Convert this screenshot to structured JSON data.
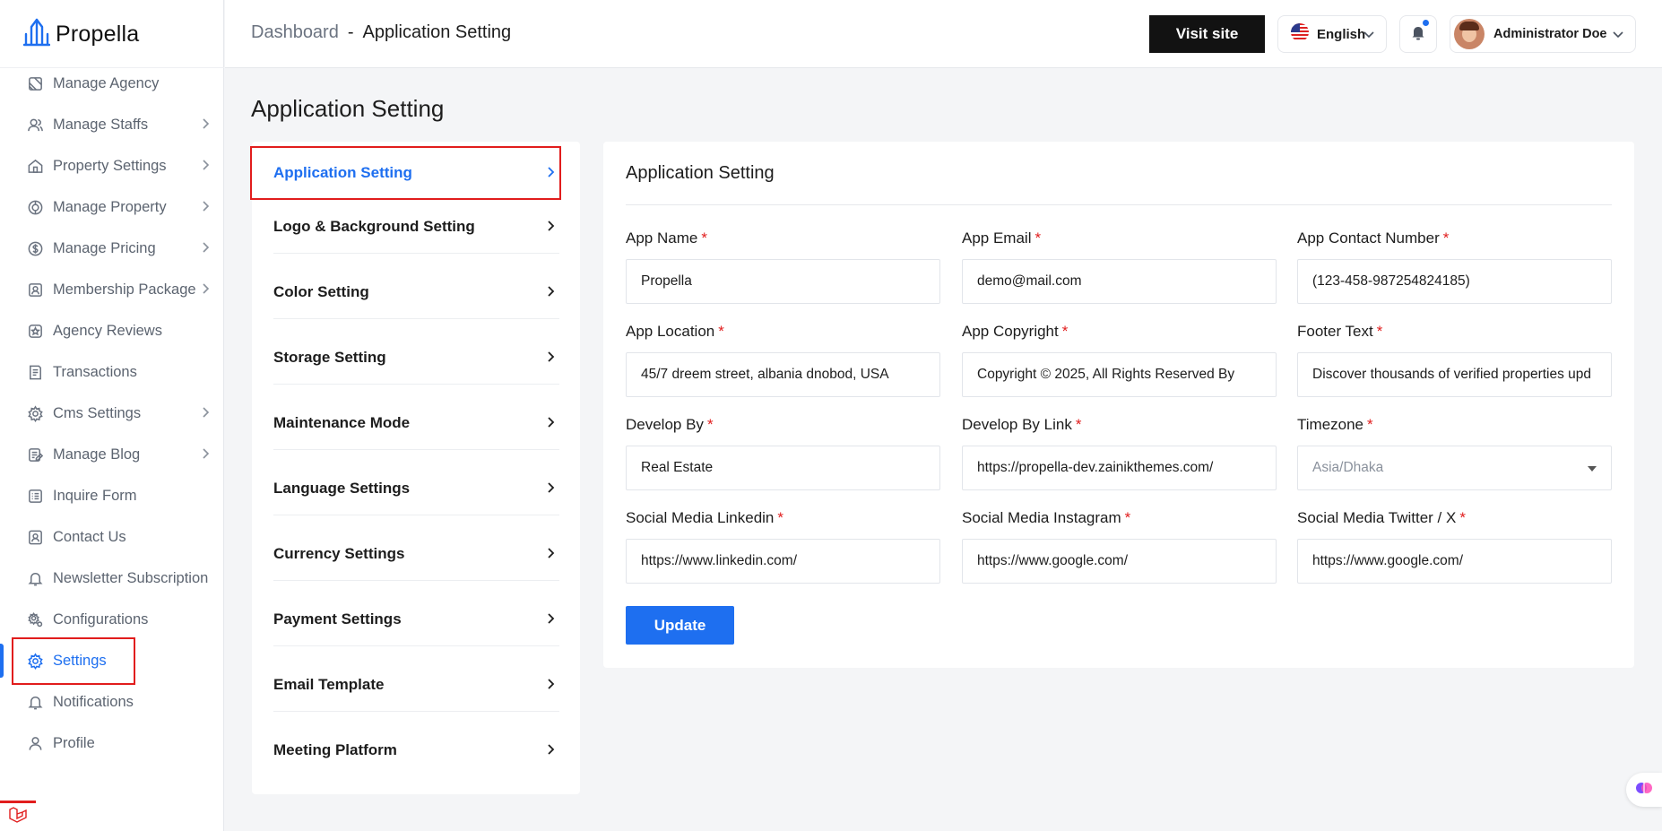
{
  "brand": {
    "name": "Propella",
    "accent": "#1e6ff0"
  },
  "sidebar": {
    "items": [
      {
        "label": "Manage Agency",
        "icon": "agency-icon",
        "chevron": false
      },
      {
        "label": "Manage Staffs",
        "icon": "users-icon",
        "chevron": true
      },
      {
        "label": "Property Settings",
        "icon": "home-icon",
        "chevron": true
      },
      {
        "label": "Manage Property",
        "icon": "property-icon",
        "chevron": true
      },
      {
        "label": "Manage Pricing",
        "icon": "dollar-icon",
        "chevron": true
      },
      {
        "label": "Membership Package",
        "icon": "membership-icon",
        "chevron": true
      },
      {
        "label": "Agency Reviews",
        "icon": "star-icon",
        "chevron": false
      },
      {
        "label": "Transactions",
        "icon": "receipt-icon",
        "chevron": false
      },
      {
        "label": "Cms Settings",
        "icon": "cog-icon",
        "chevron": true
      },
      {
        "label": "Manage Blog",
        "icon": "blog-icon",
        "chevron": true
      },
      {
        "label": "Inquire Form",
        "icon": "list-icon",
        "chevron": false
      },
      {
        "label": "Contact Us",
        "icon": "contact-icon",
        "chevron": false
      },
      {
        "label": "Newsletter Subscription",
        "icon": "bell-icon",
        "chevron": false
      },
      {
        "label": "Configurations",
        "icon": "cogs-icon",
        "chevron": false
      },
      {
        "label": "Settings",
        "icon": "settings-icon",
        "chevron": false,
        "active": true
      },
      {
        "label": "Notifications",
        "icon": "bell-icon",
        "chevron": false
      },
      {
        "label": "Profile",
        "icon": "user-icon",
        "chevron": false
      }
    ]
  },
  "header": {
    "breadcrumb": {
      "parent": "Dashboard",
      "separator": "-",
      "current": "Application Setting"
    },
    "visit_site": "Visit site",
    "language": "English",
    "user_name": "Administrator Doe"
  },
  "page_title": "Application Setting",
  "settings_tabs": [
    {
      "label": "Application Setting",
      "active": true
    },
    {
      "label": "Logo & Background Setting"
    },
    {
      "label": "Color Setting"
    },
    {
      "label": "Storage Setting"
    },
    {
      "label": "Maintenance Mode"
    },
    {
      "label": "Language Settings"
    },
    {
      "label": "Currency Settings"
    },
    {
      "label": "Payment Settings"
    },
    {
      "label": "Email Template"
    },
    {
      "label": "Meeting Platform"
    }
  ],
  "form": {
    "title": "Application Setting",
    "required_mark": "*",
    "fields": [
      {
        "label": "App Name",
        "value": "Propella"
      },
      {
        "label": "App Email",
        "value": "demo@mail.com"
      },
      {
        "label": "App Contact Number",
        "value": "(123-458-987254824185)"
      },
      {
        "label": "App Location",
        "value": "45/7 dreem street, albania dnobod, USA"
      },
      {
        "label": "App Copyright",
        "value": "Copyright © 2025, All Rights Reserved By"
      },
      {
        "label": "Footer Text",
        "value": "Discover thousands of verified properties upd"
      },
      {
        "label": "Develop By",
        "value": "Real Estate"
      },
      {
        "label": "Develop By Link",
        "value": "https://propella-dev.zainikthemes.com/"
      },
      {
        "label": "Timezone",
        "value": "Asia/Dhaka",
        "type": "select"
      },
      {
        "label": "Social Media Linkedin",
        "value": "https://www.linkedin.com/"
      },
      {
        "label": "Social Media Instagram",
        "value": "https://www.google.com/"
      },
      {
        "label": "Social Media Twitter / X",
        "value": "https://www.google.com/"
      }
    ],
    "submit_label": "Update"
  }
}
